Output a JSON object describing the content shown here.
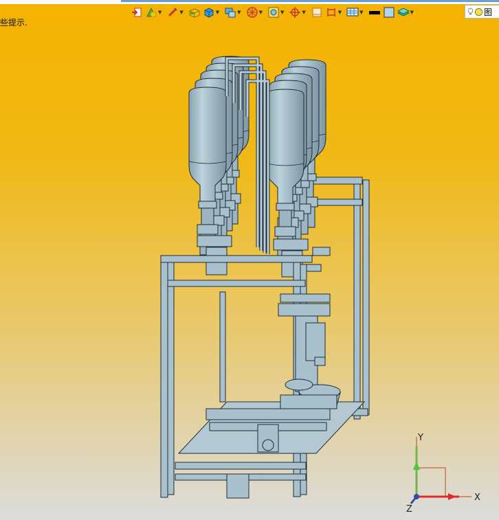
{
  "status": {
    "hint_text": "些提示."
  },
  "toolbar": {
    "tools": [
      {
        "icon": "sketch-exit-icon",
        "dropdown": false
      },
      {
        "icon": "feature-shape-icon",
        "dropdown": true
      },
      {
        "icon": "edit-tool-icon",
        "dropdown": true
      },
      {
        "icon": "solid-block-icon",
        "dropdown": false
      },
      {
        "icon": "box-view-icon",
        "dropdown": true
      },
      {
        "icon": "standard-views-icon",
        "dropdown": true
      },
      {
        "icon": "wheel-icon",
        "dropdown": true
      },
      {
        "icon": "zoom-fit-icon",
        "dropdown": true
      },
      {
        "icon": "snap-target-icon",
        "dropdown": true
      },
      {
        "icon": "sheet-icon",
        "dropdown": false
      },
      {
        "icon": "section-icon",
        "dropdown": true
      },
      {
        "icon": "display-grid-icon",
        "dropdown": true
      },
      {
        "icon": "line-color-icon",
        "dropdown": false
      },
      {
        "icon": "fill-color-icon",
        "dropdown": false
      },
      {
        "icon": "layer-stack-icon",
        "dropdown": true
      }
    ],
    "search": {
      "label": "图"
    }
  },
  "axes": {
    "x": "X",
    "y": "Y",
    "z": "Z"
  },
  "colors": {
    "accent": "#2a6ad8",
    "part_fill": "#a9c1cc",
    "part_stroke": "#1e2a33",
    "bg_top": "#f5b200",
    "bg_bottom": "#dcdcdc"
  }
}
